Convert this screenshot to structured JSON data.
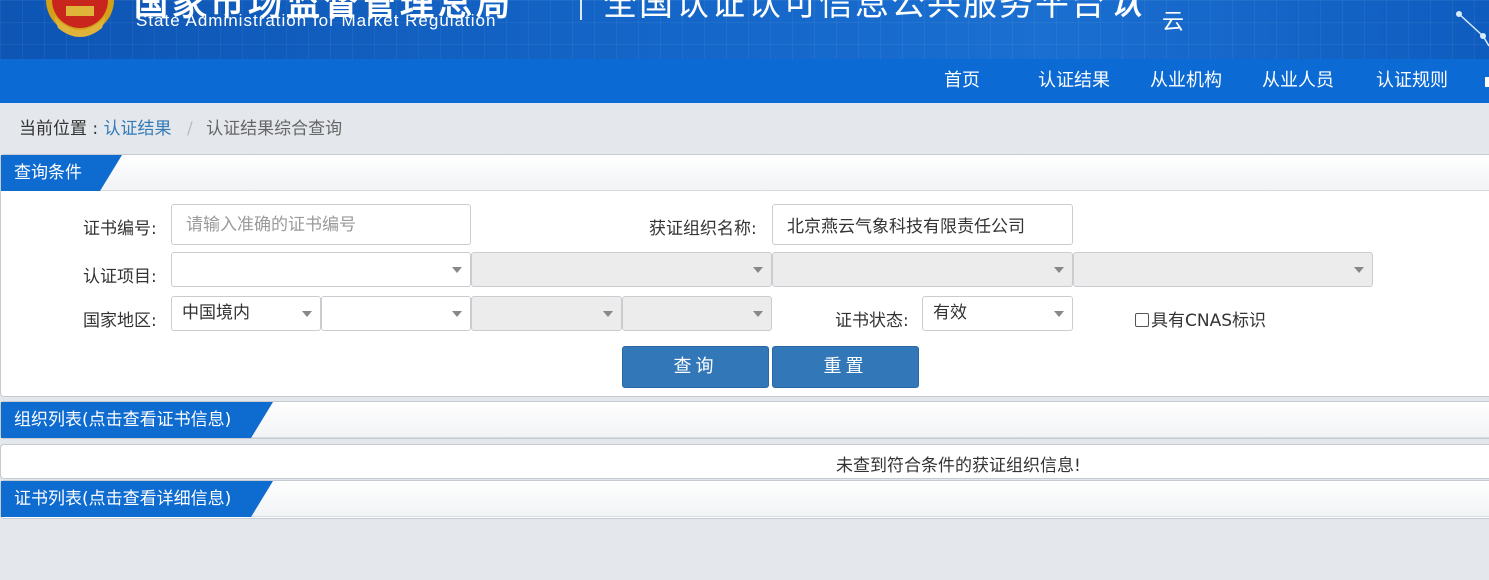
{
  "header": {
    "agency_cn": "国家市场监督管理总局",
    "agency_en": "State Administration for Market Regulation",
    "platform_title": "全国认证认可信息公共服务平台",
    "platform_logo": "认",
    "platform_logo_sub": "云",
    "colors": {
      "banner": "#1466c8",
      "nav": "#0b6ad3",
      "accent": "#3278b9"
    }
  },
  "nav": {
    "items": [
      {
        "label": "首页"
      },
      {
        "label": "认证结果"
      },
      {
        "label": "从业机构"
      },
      {
        "label": "从业人员"
      },
      {
        "label": "认证规则"
      }
    ]
  },
  "breadcrumb": {
    "label": "当前位置 :",
    "link": "认证结果",
    "separator": "/",
    "current": "认证结果综合查询"
  },
  "query": {
    "title": "查询条件",
    "cert_no_label": "证书编号:",
    "cert_no_placeholder": "请输入准确的证书编号",
    "cert_no_value": "",
    "org_name_label": "获证组织名称:",
    "org_name_value": "北京燕云气象科技有限责任公司",
    "project_label": "认证项目:",
    "project_selects": [
      "",
      "",
      "",
      ""
    ],
    "region_label": "国家地区:",
    "region_selects": [
      "中国境内",
      "",
      "",
      ""
    ],
    "status_label": "证书状态:",
    "status_value": "有效",
    "cnas_label": "具有CNAS标识",
    "cnas_checked": false,
    "search_button": "查询",
    "reset_button": "重置"
  },
  "org_list": {
    "title": "组织列表(点击查看证书信息)",
    "empty_message": "未查到符合条件的获证组织信息!"
  },
  "cert_list": {
    "title": "证书列表(点击查看详细信息)"
  }
}
